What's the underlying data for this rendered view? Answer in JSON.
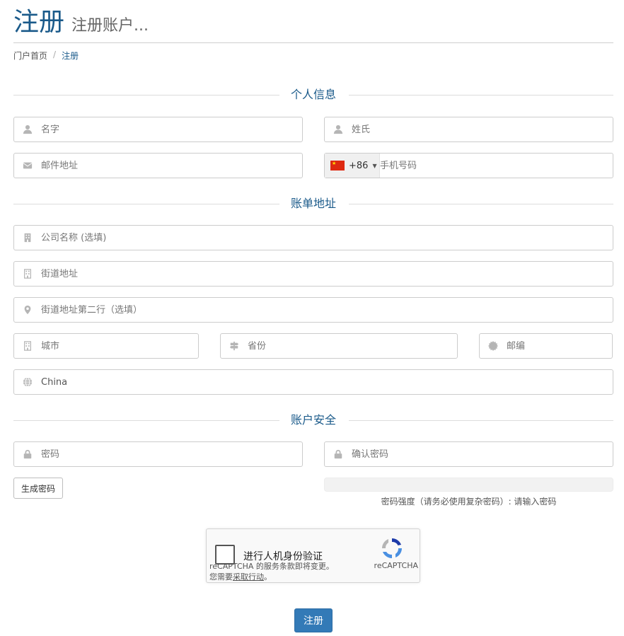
{
  "header": {
    "title": "注册",
    "subtitle": "注册账户..."
  },
  "breadcrumb": {
    "home": "门户首页",
    "separator": "/",
    "current": "注册"
  },
  "sections": {
    "personal": "个人信息",
    "billing": "账单地址",
    "security": "账户安全"
  },
  "fields": {
    "first_name": {
      "placeholder": "名字",
      "icon": "user-icon"
    },
    "last_name": {
      "placeholder": "姓氏",
      "icon": "user-icon"
    },
    "email": {
      "placeholder": "邮件地址",
      "icon": "envelope-icon"
    },
    "phone": {
      "placeholder": "手机号码",
      "country_code": "+86",
      "flag": "china-flag"
    },
    "company": {
      "placeholder": "公司名称 (选填)",
      "icon": "building-icon"
    },
    "address1": {
      "placeholder": "街道地址",
      "icon": "building-icon"
    },
    "address2": {
      "placeholder": "街道地址第二行（选填）",
      "icon": "map-marker-icon"
    },
    "city": {
      "placeholder": "城市",
      "icon": "building-icon"
    },
    "state": {
      "placeholder": "省份",
      "icon": "signpost-icon"
    },
    "postcode": {
      "placeholder": "邮编",
      "icon": "certificate-icon"
    },
    "country": {
      "value": "China",
      "icon": "globe-icon"
    },
    "password": {
      "placeholder": "密码",
      "icon": "lock-icon"
    },
    "password_confirm": {
      "placeholder": "确认密码",
      "icon": "lock-icon"
    }
  },
  "password_tools": {
    "generate_label": "生成密码",
    "strength_text": "密码强度（请务必使用复杂密码）: 请输入密码"
  },
  "recaptcha": {
    "checkbox_label": "进行人机身份验证",
    "brand": "reCAPTCHA",
    "terms_prefix": "reCAPTCHA 的服务条款即将变更。您需要",
    "terms_link": "采取行动",
    "terms_suffix": "。"
  },
  "submit": {
    "label": "注册"
  },
  "colors": {
    "accent": "#1a5a8a",
    "button": "#337ab7",
    "border": "#cccccc"
  }
}
